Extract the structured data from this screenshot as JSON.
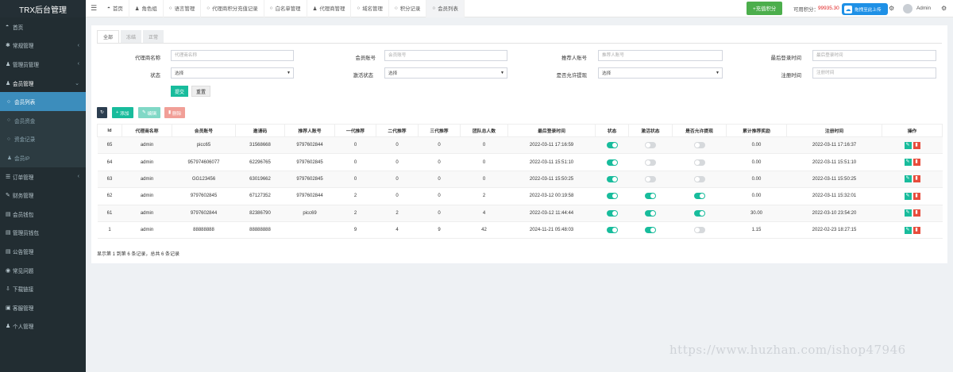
{
  "app": {
    "title": "TRX后台管理"
  },
  "sidebar": {
    "items": [
      {
        "label": "首页",
        "icon": "dashboard-icon",
        "glyph": "◓",
        "arrow": ""
      },
      {
        "label": "常规管理",
        "icon": "cogs-icon",
        "glyph": "✱",
        "arrow": "‹"
      },
      {
        "label": "管理员管理",
        "icon": "users-icon",
        "glyph": "♟",
        "arrow": "‹"
      },
      {
        "label": "会员管理",
        "icon": "user-icon",
        "glyph": "♟",
        "arrow": "⌄",
        "open": true
      }
    ],
    "sub_items": [
      {
        "label": "会员列表",
        "active": true
      },
      {
        "label": "会员资金",
        "active": false
      },
      {
        "label": "资金记录",
        "active": false
      },
      {
        "label": "会员IP",
        "active": false
      }
    ],
    "items2": [
      {
        "label": "订单管理",
        "icon": "list-icon",
        "glyph": "☰",
        "arrow": "‹"
      },
      {
        "label": "财务管理",
        "icon": "edit-icon",
        "glyph": "✎",
        "arrow": ""
      },
      {
        "label": "会员钱包",
        "icon": "wallet-icon",
        "glyph": "▤",
        "arrow": ""
      },
      {
        "label": "管理员钱包",
        "icon": "wallet-icon",
        "glyph": "▤",
        "arrow": ""
      },
      {
        "label": "公告管理",
        "icon": "notice-icon",
        "glyph": "▤",
        "arrow": ""
      },
      {
        "label": "常见问题",
        "icon": "question-icon",
        "glyph": "◉",
        "arrow": ""
      },
      {
        "label": "下载链接",
        "icon": "download-icon",
        "glyph": "⇩",
        "arrow": ""
      },
      {
        "label": "客服管理",
        "icon": "service-icon",
        "glyph": "▣",
        "arrow": ""
      },
      {
        "label": "个人管理",
        "icon": "person-icon",
        "glyph": "♟",
        "arrow": ""
      }
    ]
  },
  "topbar": {
    "tabs": [
      {
        "label": "首页",
        "glyph": "◓",
        "icon": "dashboard-icon",
        "active": false
      },
      {
        "label": "角色组",
        "glyph": "♟",
        "icon": "group-icon",
        "active": false
      },
      {
        "label": "语言管理",
        "glyph": "○",
        "icon": "circle-icon",
        "active": false
      },
      {
        "label": "代理商积分充值记录",
        "glyph": "○",
        "icon": "circle-icon",
        "active": false
      },
      {
        "label": "白名单管理",
        "glyph": "○",
        "icon": "circle-icon",
        "active": false
      },
      {
        "label": "代理商管理",
        "glyph": "♟",
        "icon": "user-icon",
        "active": false
      },
      {
        "label": "域名管理",
        "glyph": "○",
        "icon": "circle-icon",
        "active": false
      },
      {
        "label": "积分记录",
        "glyph": "○",
        "icon": "circle-icon",
        "active": false
      },
      {
        "label": "会员列表",
        "glyph": "○",
        "icon": "circle-icon",
        "active": true
      }
    ],
    "recharge_label": "+充值积分",
    "points_label": "可用积分：",
    "points_value": "99935.30",
    "upload_label": "拖拽至此上传",
    "admin_name": "Admin"
  },
  "panel": {
    "tabs": [
      "全部",
      "冻结",
      "正常"
    ],
    "form": {
      "agent_label": "代理商名称",
      "agent_placeholder": "代理商名称",
      "account_label": "会员账号",
      "account_placeholder": "会员账号",
      "referrer_label": "推荐人账号",
      "referrer_placeholder": "推荐人账号",
      "lastlogin_label": "最后登录时间",
      "lastlogin_placeholder": "最后登录时间",
      "status_label": "状态",
      "status_value": "选择",
      "activate_label": "激活状态",
      "activate_value": "选择",
      "withdraw_label": "是否允许提现",
      "withdraw_value": "选择",
      "regtime_label": "注册时间",
      "regtime_placeholder": "注册时间",
      "submit": "提交",
      "reset": "重置"
    },
    "toolbar": {
      "add": "添加",
      "edit": "编辑",
      "delete": "删除"
    },
    "columns": [
      "Id",
      "代理商名称",
      "会员账号",
      "邀请码",
      "推荐人账号",
      "一代推荐",
      "二代推荐",
      "三代推荐",
      "团队总人数",
      "最后登录时间",
      "状态",
      "激活状态",
      "是否允许提现",
      "累计推荐奖励",
      "注册时间",
      "操作"
    ],
    "rows": [
      {
        "id": "65",
        "agent": "admin",
        "account": "picc65",
        "invite": "31568668",
        "referrer": "9797602844",
        "g1": "0",
        "g2": "0",
        "g3": "0",
        "team": "0",
        "last": "2022-03-11 17:16:59",
        "status": true,
        "active": false,
        "withdraw": false,
        "reward": "0.00",
        "reg": "2022-03-11 17:16:37"
      },
      {
        "id": "64",
        "agent": "admin",
        "account": "957974606077",
        "invite": "62296765",
        "referrer": "9797602845",
        "g1": "0",
        "g2": "0",
        "g3": "0",
        "team": "0",
        "last": "2022-03-11 15:51:10",
        "status": true,
        "active": false,
        "withdraw": false,
        "reward": "0.00",
        "reg": "2022-03-11 15:51:10"
      },
      {
        "id": "63",
        "agent": "admin",
        "account": "GG123456",
        "invite": "63019662",
        "referrer": "9797602845",
        "g1": "0",
        "g2": "0",
        "g3": "0",
        "team": "0",
        "last": "2022-03-11 15:50:25",
        "status": true,
        "active": false,
        "withdraw": false,
        "reward": "0.00",
        "reg": "2022-03-11 15:50:25"
      },
      {
        "id": "62",
        "agent": "admin",
        "account": "9797602845",
        "invite": "67127352",
        "referrer": "9797602844",
        "g1": "2",
        "g2": "0",
        "g3": "0",
        "team": "2",
        "last": "2022-03-12 00:19:58",
        "status": true,
        "active": true,
        "withdraw": true,
        "reward": "0.00",
        "reg": "2022-03-11 15:32:01"
      },
      {
        "id": "61",
        "agent": "admin",
        "account": "9797602844",
        "invite": "82386790",
        "referrer": "picc69",
        "g1": "2",
        "g2": "2",
        "g3": "0",
        "team": "4",
        "last": "2022-03-12 11:44:44",
        "status": true,
        "active": true,
        "withdraw": true,
        "reward": "30.00",
        "reg": "2022-03-10 23:54:20"
      },
      {
        "id": "1",
        "agent": "admin",
        "account": "88888888",
        "invite": "88888888",
        "referrer": "",
        "g1": "9",
        "g2": "4",
        "g3": "9",
        "team": "42",
        "last": "2024-11-21 05:48:03",
        "status": true,
        "active": true,
        "withdraw": false,
        "reward": "1.15",
        "reg": "2022-02-23 18:27:15"
      }
    ],
    "pager": "显示第 1 到第 6 条记录，总共 6 条记录"
  },
  "watermark": "https://www.huzhan.com/ishop47946"
}
